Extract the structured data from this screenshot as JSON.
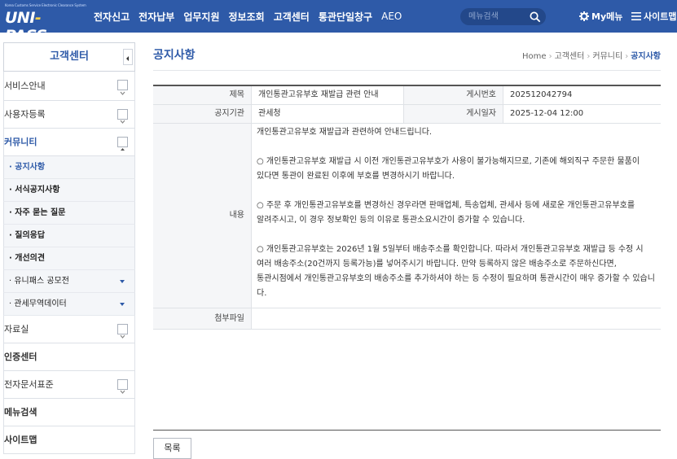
{
  "header": {
    "logo_sub": "Korea Customs Service Electronic Clearance System",
    "logo_main_left": "UNI",
    "logo_main_dash": "-",
    "logo_main_right": "PASS",
    "menu": [
      "전자신고",
      "전자납부",
      "업무지원",
      "정보조회",
      "고객센터",
      "통관단일창구",
      "AEO"
    ],
    "search_placeholder": "메뉴검색",
    "my_menu": "My메뉴",
    "sitemap": "사이트맵"
  },
  "sidebar": {
    "title": "고객센터",
    "items": [
      {
        "label": "서비스안내",
        "toggle": "expand"
      },
      {
        "label": "사용자등록",
        "toggle": "expand"
      },
      {
        "label": "커뮤니티",
        "toggle": "collapse"
      }
    ],
    "sub_items": [
      {
        "label": "· 공지사항",
        "current": true
      },
      {
        "label": "· 서식공지사항"
      },
      {
        "label": "· 자주 묻는 질문"
      },
      {
        "label": "· 질의응답"
      },
      {
        "label": "· 개선의견"
      },
      {
        "label": "· 유니패스 공모전",
        "arrow": true
      },
      {
        "label": "· 관세무역데이터",
        "arrow": true
      }
    ],
    "items_after": [
      {
        "label": "자료실",
        "toggle": "expand"
      },
      {
        "label": "인증센터"
      },
      {
        "label": "전자문서표준",
        "toggle": "expand"
      },
      {
        "label": "메뉴검색"
      },
      {
        "label": "사이트맵"
      }
    ]
  },
  "page": {
    "title": "공지사항",
    "breadcrumb": [
      "Home",
      "고객센터",
      "커뮤니티",
      "공지사항"
    ]
  },
  "notice": {
    "subject_label": "제목",
    "subject": "개인통관고유부호 재발급 관련 안내",
    "number_label": "게시번호",
    "number": "202512042794",
    "org_label": "공지기관",
    "org": "관세청",
    "date_label": "게시일자",
    "date": "2025-12-04 12:00",
    "content_label": "내용",
    "content": [
      "개인통관고유부호 재발급과 관련하여 안내드립니다.",
      "",
      "○ 개인통관고유부호 재발급 시 이전 개인통관고유부호가 사용이 불가능해지므로, 기존에 해외직구 주문한 물품이",
      "  있다면 통관이 완료된 이후에 부호를 변경하시기 바랍니다.",
      "",
      "○ 주문 후 개인통관고유부호를 변경하신 경우라면 판매업체, 특송업체, 관세사 등에 새로운 개인통관고유부호를",
      "  알려주시고, 이 경우 정보확인 등의 이유로 통관소요시간이 증가할 수 있습니다.",
      "",
      "○ 개인통관고유부호는 2026년 1월 5일부터 배송주소를 확인합니다. 따라서 개인통관고유부호 재발급 등 수정 시",
      "  여러 배송주소(20건까지 등록가능)를 넣어주시기 바랍니다. 만약 등록하지 않은 배송주소로 주문하신다면,",
      "  통관시점에서 개인통관고유부호의 배송주소를 추가하셔야 하는 등 수정이 필요하며 통관시간이 매우 증가할 수 있습니다."
    ],
    "attach_label": "첨부파일",
    "attach": ""
  },
  "buttons": {
    "list": "목록"
  },
  "colors": {
    "brand": "#2e5aa8",
    "header_bg": "#2e5aa8"
  }
}
